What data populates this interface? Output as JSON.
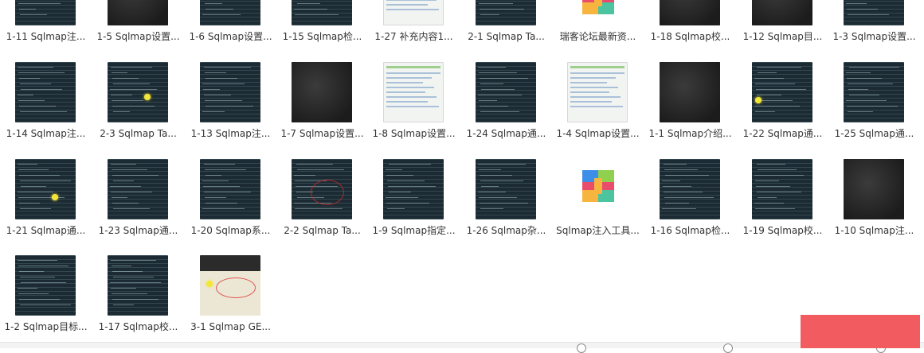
{
  "files": [
    {
      "label": "1-11 Sqlmap注...",
      "kind": "terminal"
    },
    {
      "label": "1-5 Sqlmap设置...",
      "kind": "dark"
    },
    {
      "label": "1-6 Sqlmap设置...",
      "kind": "terminal"
    },
    {
      "label": "1-15 Sqlmap检...",
      "kind": "terminal"
    },
    {
      "label": "1-27 补充内容1...",
      "kind": "light"
    },
    {
      "label": "2-1 Sqlmap Ta...",
      "kind": "terminal"
    },
    {
      "label": "瑞客论坛最新资...",
      "kind": "archive"
    },
    {
      "label": "1-18 Sqlmap校...",
      "kind": "dark"
    },
    {
      "label": "1-12 Sqlmap目...",
      "kind": "dark"
    },
    {
      "label": "1-3 Sqlmap设置...",
      "kind": "terminal"
    },
    {
      "label": "1-14 Sqlmap注...",
      "kind": "terminal"
    },
    {
      "label": "2-3 Sqlmap Ta...",
      "kind": "terminal-dot"
    },
    {
      "label": "1-13 Sqlmap注...",
      "kind": "terminal"
    },
    {
      "label": "1-7 Sqlmap设置...",
      "kind": "dark"
    },
    {
      "label": "1-8 Sqlmap设置...",
      "kind": "light"
    },
    {
      "label": "1-24 Sqlmap通...",
      "kind": "terminal"
    },
    {
      "label": "1-4 Sqlmap设置...",
      "kind": "light"
    },
    {
      "label": "1-1 Sqlmap介绍...",
      "kind": "dark"
    },
    {
      "label": "1-22 Sqlmap通...",
      "kind": "terminal-dot"
    },
    {
      "label": "1-25 Sqlmap通...",
      "kind": "terminal"
    },
    {
      "label": "1-21 Sqlmap通...",
      "kind": "terminal-dot"
    },
    {
      "label": "1-23 Sqlmap通...",
      "kind": "terminal"
    },
    {
      "label": "1-20 Sqlmap系...",
      "kind": "terminal"
    },
    {
      "label": "2-2 Sqlmap Ta...",
      "kind": "terminal-red"
    },
    {
      "label": "1-9 Sqlmap指定...",
      "kind": "terminal"
    },
    {
      "label": "1-26 Sqlmap杂...",
      "kind": "terminal"
    },
    {
      "label": "Sqlmap注入工具...",
      "kind": "archive"
    },
    {
      "label": "1-16 Sqlmap检...",
      "kind": "terminal"
    },
    {
      "label": "1-19 Sqlmap校...",
      "kind": "terminal"
    },
    {
      "label": "1-10 Sqlmap注...",
      "kind": "dark"
    },
    {
      "label": "1-2 Sqlmap目标...",
      "kind": "terminal"
    },
    {
      "label": "1-17 Sqlmap校...",
      "kind": "terminal"
    },
    {
      "label": "3-1 Sqlmap GE...",
      "kind": "paper"
    }
  ],
  "colors": {
    "archive_q1": "#3d8ee6",
    "archive_q2": "#8fd14f",
    "archive_q3": "#f7b43f",
    "archive_q4": "#4cc4a0",
    "watermark": "#f25b60"
  }
}
